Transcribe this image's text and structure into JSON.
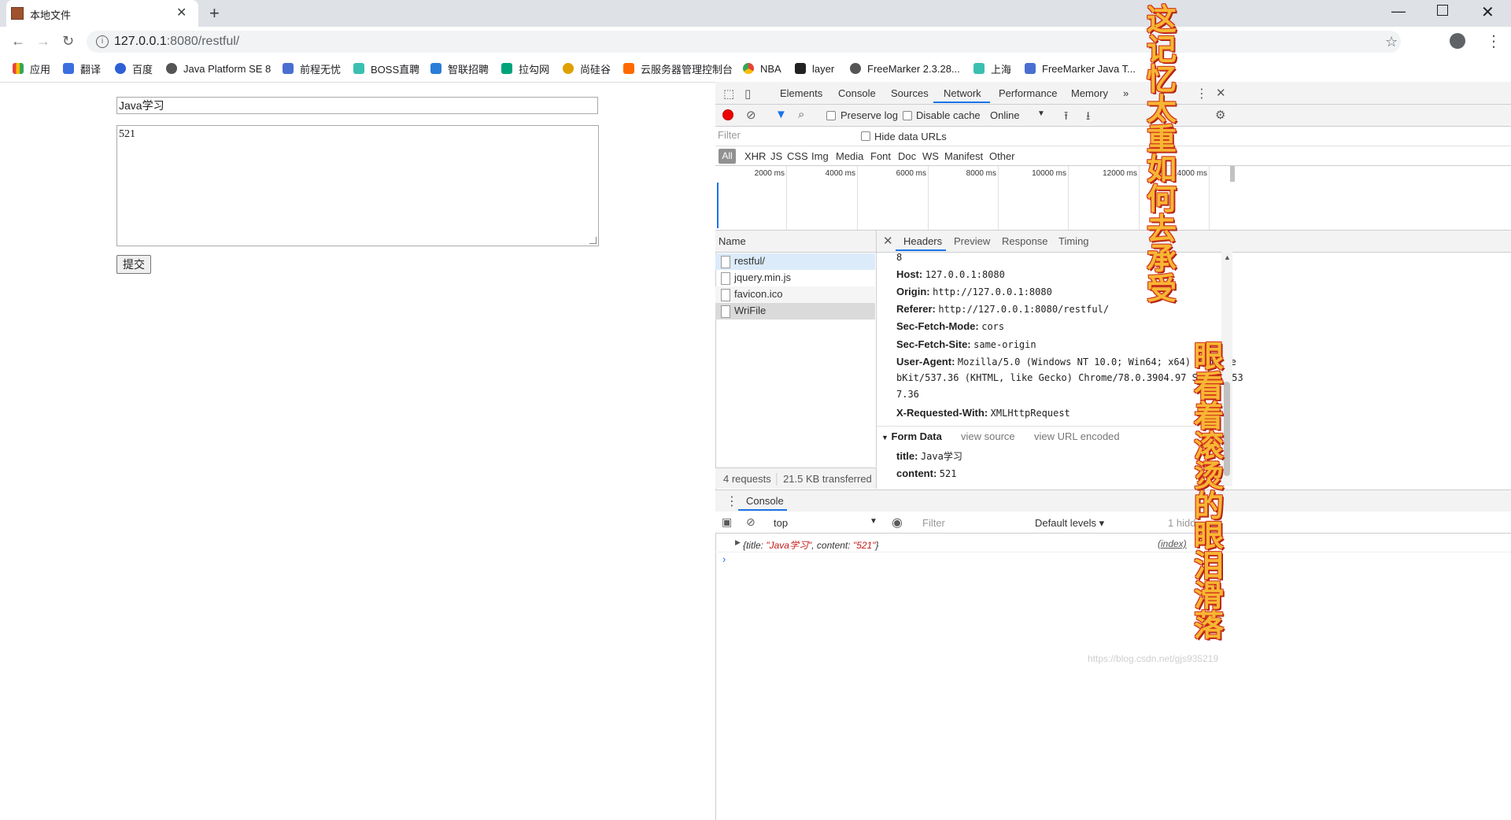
{
  "browser": {
    "tab_title": "本地文件",
    "url_host": "127.0.0.1",
    "url_rest": ":8080/restful/",
    "bookmarks": [
      "应用",
      "翻译",
      "百度",
      "Java Platform SE 8",
      "前程无忧",
      "BOSS直聘",
      "智联招聘",
      "拉勾网",
      "尚硅谷",
      "云服务器管理控制台",
      "NBA",
      "layer",
      "FreeMarker 2.3.28...",
      "上海",
      "FreeMarker Java T..."
    ]
  },
  "form": {
    "title_value": "Java学习",
    "content_value": "521",
    "submit_label": "提交"
  },
  "devtools": {
    "tabs": [
      "Elements",
      "Console",
      "Sources",
      "Network",
      "Performance",
      "Memory",
      "»"
    ],
    "active_tab": "Network",
    "preserve_log": "Preserve log",
    "disable_cache": "Disable cache",
    "throttle": "Online",
    "filter_placeholder": "Filter",
    "hide_data_urls": "Hide data URLs",
    "types": [
      "XHR",
      "JS",
      "CSS",
      "Img",
      "Media",
      "Font",
      "Doc",
      "WS",
      "Manifest",
      "Other"
    ],
    "type_all": "All",
    "timeline_ticks": [
      "2000 ms",
      "4000 ms",
      "6000 ms",
      "8000 ms",
      "10000 ms",
      "12000 ms",
      "14000 ms"
    ],
    "name_header": "Name",
    "requests": [
      "restful/",
      "jquery.min.js",
      "favicon.ico",
      "WriFile"
    ],
    "selected_request": "WriFile",
    "status_requests": "4 requests",
    "status_transferred": "21.5 KB transferred",
    "detail_tabs": [
      "Headers",
      "Preview",
      "Response",
      "Timing"
    ],
    "partial_value": "8",
    "headers": [
      {
        "key": "Host:",
        "value": "127.0.0.1:8080"
      },
      {
        "key": "Origin:",
        "value": "http://127.0.0.1:8080"
      },
      {
        "key": "Referer:",
        "value": "http://127.0.0.1:8080/restful/"
      },
      {
        "key": "Sec-Fetch-Mode:",
        "value": "cors"
      },
      {
        "key": "Sec-Fetch-Site:",
        "value": "same-origin"
      },
      {
        "key": "User-Agent:",
        "value": "Mozilla/5.0 (Windows NT 10.0; Win64; x64) AppleWe"
      },
      {
        "key": "",
        "value": "bKit/537.36 (KHTML, like Gecko) Chrome/78.0.3904.97 Safari/53"
      },
      {
        "key": "",
        "value": "7.36"
      },
      {
        "key": "X-Requested-With:",
        "value": "XMLHttpRequest"
      }
    ],
    "form_data": {
      "title": "Form Data",
      "view_source": "view source",
      "view_url_encoded": "view URL encoded",
      "fields": [
        {
          "key": "title:",
          "value": "Java学习"
        },
        {
          "key": "content:",
          "value": "521"
        }
      ]
    },
    "drawer": {
      "tab": "Console",
      "context": "top",
      "filter_placeholder": "Filter",
      "levels": "Default levels ▾",
      "hidden": "1 hidd",
      "log_prefix": "{title: ",
      "log_title": "\"Java学习\"",
      "log_mid": ", content: ",
      "log_content": "\"521\"",
      "log_suffix": "}",
      "log_source": "(index)",
      "prompt": "›"
    }
  },
  "overlay": {
    "line1": "这记忆太重如何去承受",
    "line2": "眼看着滚烫的眼泪滑落"
  },
  "watermark": "https://blog.csdn.net/gjs935219"
}
